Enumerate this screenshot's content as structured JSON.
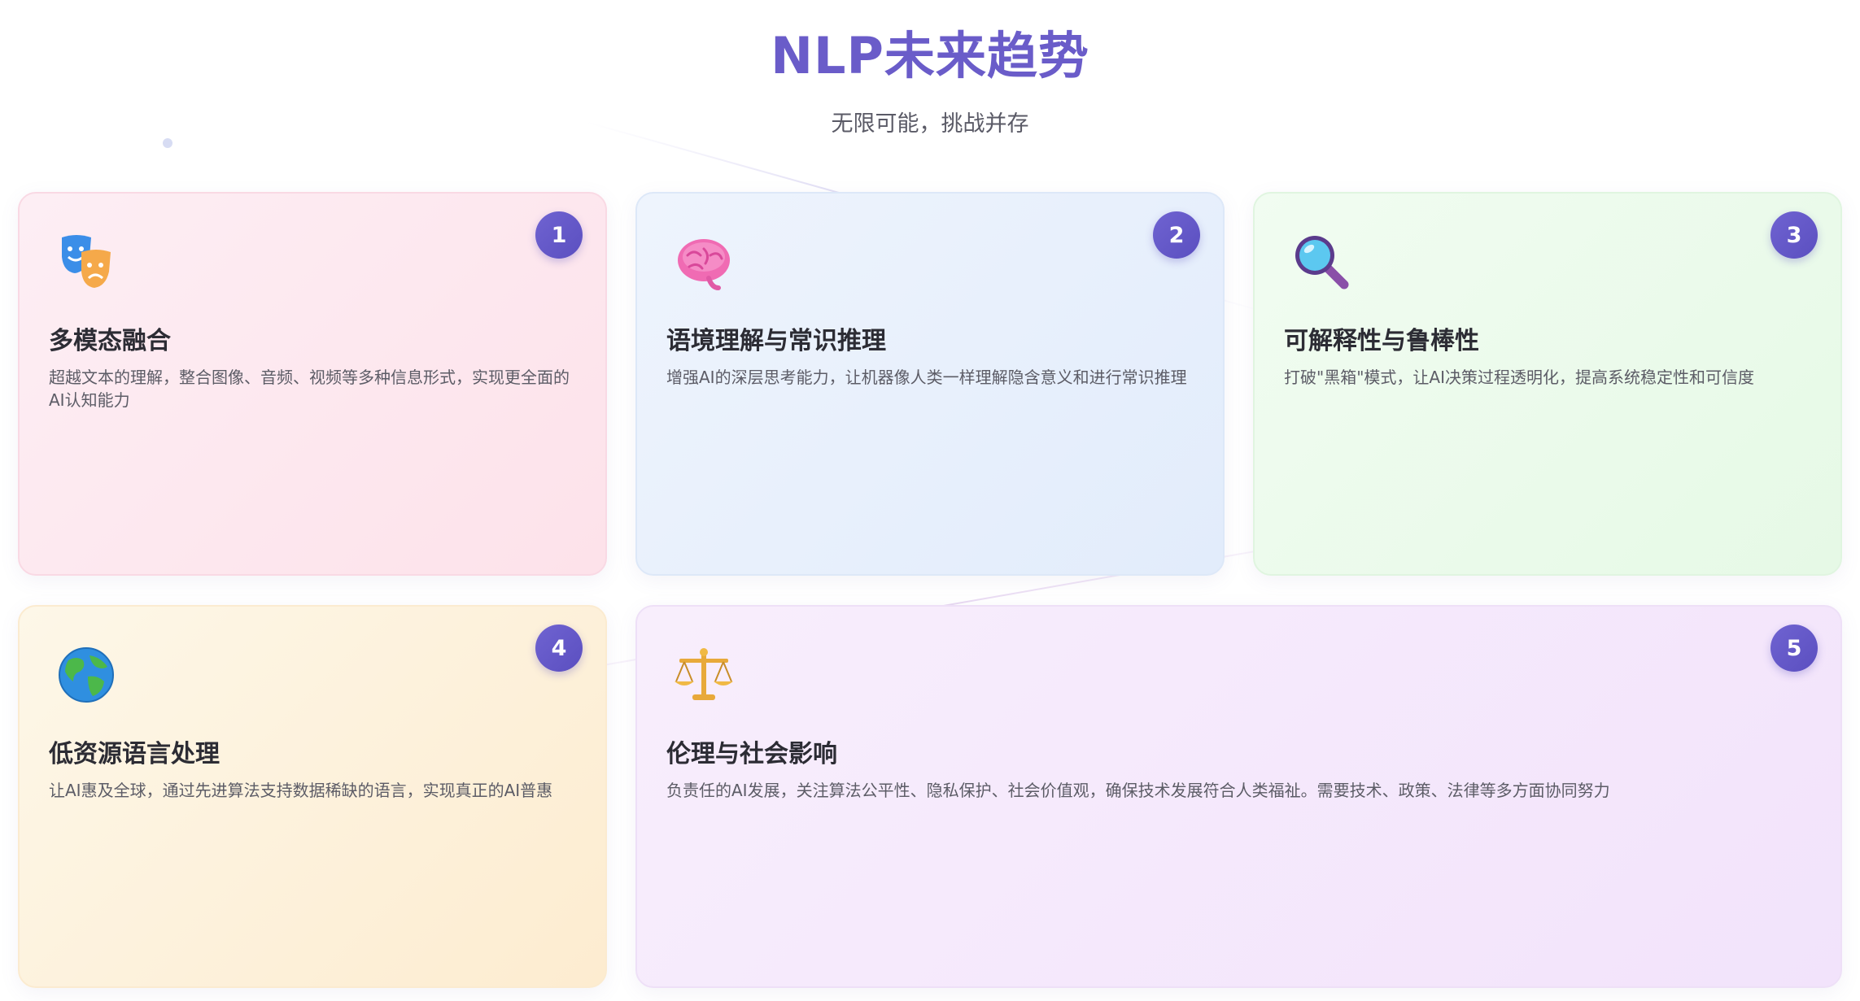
{
  "header": {
    "title": "NLP未来趋势",
    "subtitle": "无限可能，挑战并存"
  },
  "colors": {
    "accent": "#6a5cc9",
    "badge": "#5b4fc0"
  },
  "cards": [
    {
      "number": "1",
      "icon": "theater-masks-icon",
      "title": "多模态融合",
      "description": "超越文本的理解，整合图像、音频、视频等多种信息形式，实现更全面的AI认知能力"
    },
    {
      "number": "2",
      "icon": "brain-icon",
      "title": "语境理解与常识推理",
      "description": "增强AI的深层思考能力，让机器像人类一样理解隐含意义和进行常识推理"
    },
    {
      "number": "3",
      "icon": "magnifying-glass-icon",
      "title": "可解释性与鲁棒性",
      "description": "打破\"黑箱\"模式，让AI决策过程透明化，提高系统稳定性和可信度"
    },
    {
      "number": "4",
      "icon": "globe-icon",
      "title": "低资源语言处理",
      "description": "让AI惠及全球，通过先进算法支持数据稀缺的语言，实现真正的AI普惠"
    },
    {
      "number": "5",
      "icon": "balance-scale-icon",
      "title": "伦理与社会影响",
      "description": "负责任的AI发展，关注算法公平性、隐私保护、社会价值观，确保技术发展符合人类福祉。需要技术、政策、法律等多方面协同努力"
    }
  ]
}
